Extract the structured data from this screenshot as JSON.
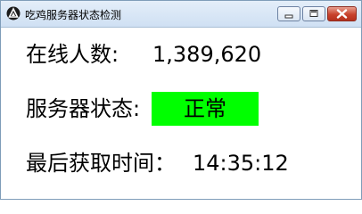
{
  "window": {
    "title": "吃鸡服务器状态检测",
    "icons": {
      "app": "app-logo-icon",
      "minimize": "minimize-icon",
      "maximize": "maximize-icon",
      "close": "close-icon"
    },
    "colors": {
      "status_ok": "#00ff00",
      "close_button": "#c8422c"
    }
  },
  "online": {
    "label": "在线人数:",
    "value": "1,389,620"
  },
  "server_status": {
    "label": "服务器状态:",
    "value": "正常"
  },
  "last_fetch": {
    "label": "最后获取时间：",
    "value": "14:35:12"
  }
}
